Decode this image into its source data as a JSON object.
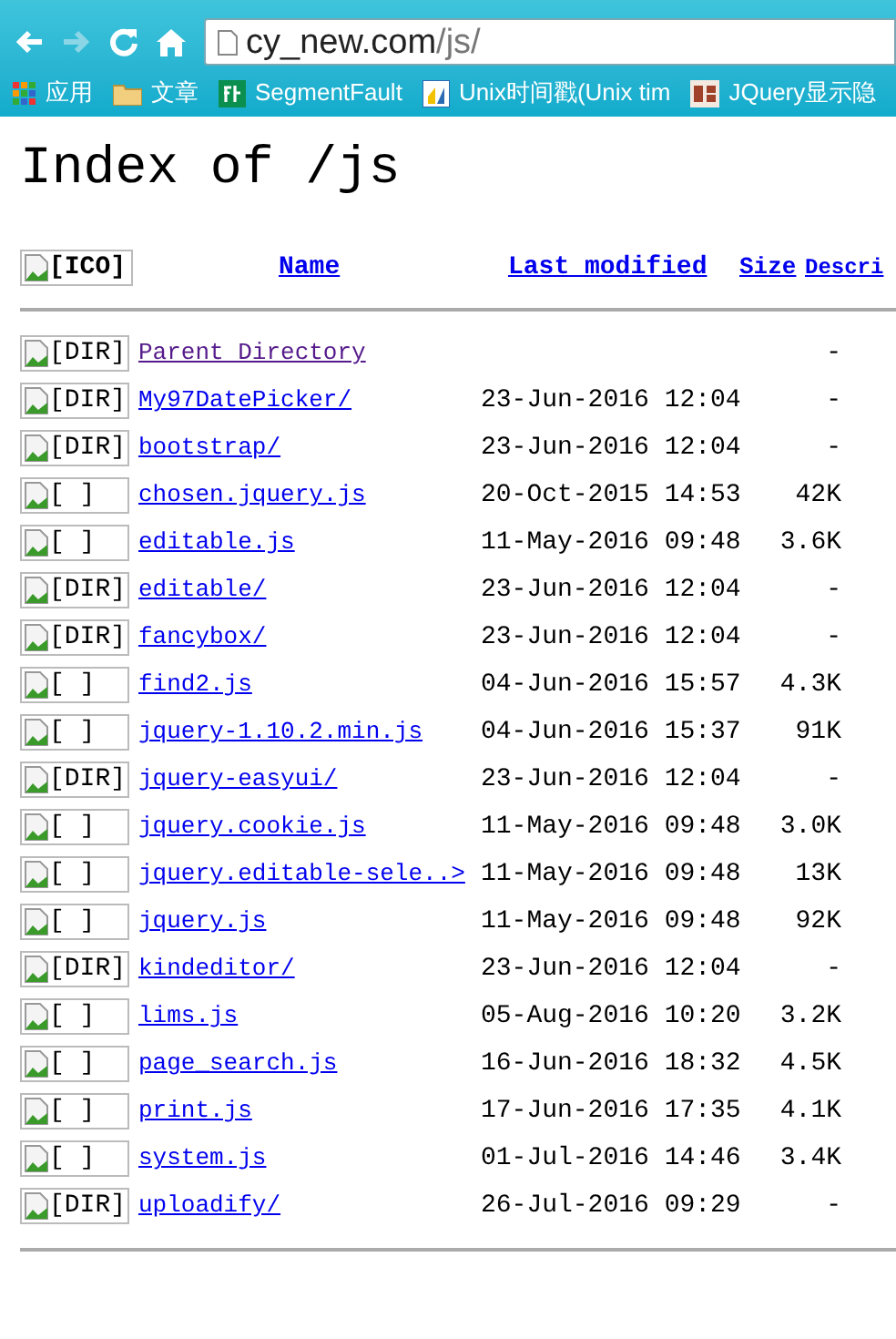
{
  "toolbar": {
    "address": {
      "host": "cy_new.com",
      "path": "/js/"
    }
  },
  "bookmarks": [
    {
      "kind": "apps",
      "label": "应用"
    },
    {
      "kind": "folder",
      "label": "文章"
    },
    {
      "kind": "sf",
      "label": "SegmentFault"
    },
    {
      "kind": "unix",
      "label": "Unix时间戳(Unix tim"
    },
    {
      "kind": "jq",
      "label": "JQuery显示隐"
    }
  ],
  "page": {
    "title": "Index of /js",
    "header": {
      "icon_alt": "[ICO]",
      "columns": [
        "Name",
        "Last modified",
        "Size",
        "Descri"
      ]
    },
    "rows": [
      {
        "alt": "[DIR]",
        "name": "Parent Directory",
        "visited": true,
        "modified": "",
        "size": "-"
      },
      {
        "alt": "[DIR]",
        "name": "My97DatePicker/",
        "visited": false,
        "modified": "23-Jun-2016 12:04",
        "size": "-"
      },
      {
        "alt": "[DIR]",
        "name": "bootstrap/",
        "visited": false,
        "modified": "23-Jun-2016 12:04",
        "size": "-"
      },
      {
        "alt": "[ ]",
        "name": "chosen.jquery.js",
        "visited": false,
        "modified": "20-Oct-2015 14:53",
        "size": "42K"
      },
      {
        "alt": "[ ]",
        "name": "editable.js",
        "visited": false,
        "modified": "11-May-2016 09:48",
        "size": "3.6K"
      },
      {
        "alt": "[DIR]",
        "name": "editable/",
        "visited": false,
        "modified": "23-Jun-2016 12:04",
        "size": "-"
      },
      {
        "alt": "[DIR]",
        "name": "fancybox/",
        "visited": false,
        "modified": "23-Jun-2016 12:04",
        "size": "-"
      },
      {
        "alt": "[ ]",
        "name": "find2.js",
        "visited": false,
        "modified": "04-Jun-2016 15:57",
        "size": "4.3K"
      },
      {
        "alt": "[ ]",
        "name": "jquery-1.10.2.min.js",
        "visited": false,
        "modified": "04-Jun-2016 15:37",
        "size": "91K"
      },
      {
        "alt": "[DIR]",
        "name": "jquery-easyui/",
        "visited": false,
        "modified": "23-Jun-2016 12:04",
        "size": "-"
      },
      {
        "alt": "[ ]",
        "name": "jquery.cookie.js",
        "visited": false,
        "modified": "11-May-2016 09:48",
        "size": "3.0K"
      },
      {
        "alt": "[ ]",
        "name": "jquery.editable-sele..>",
        "visited": false,
        "modified": "11-May-2016 09:48",
        "size": "13K"
      },
      {
        "alt": "[ ]",
        "name": "jquery.js",
        "visited": false,
        "modified": "11-May-2016 09:48",
        "size": "92K"
      },
      {
        "alt": "[DIR]",
        "name": "kindeditor/",
        "visited": false,
        "modified": "23-Jun-2016 12:04",
        "size": "-"
      },
      {
        "alt": "[ ]",
        "name": "lims.js",
        "visited": false,
        "modified": "05-Aug-2016 10:20",
        "size": "3.2K"
      },
      {
        "alt": "[ ]",
        "name": "page_search.js",
        "visited": false,
        "modified": "16-Jun-2016 18:32",
        "size": "4.5K"
      },
      {
        "alt": "[ ]",
        "name": "print.js",
        "visited": false,
        "modified": "17-Jun-2016 17:35",
        "size": "4.1K"
      },
      {
        "alt": "[ ]",
        "name": "system.js",
        "visited": false,
        "modified": "01-Jul-2016 14:46",
        "size": "3.4K"
      },
      {
        "alt": "[DIR]",
        "name": "uploadify/",
        "visited": false,
        "modified": "26-Jul-2016 09:29",
        "size": "-"
      }
    ]
  }
}
